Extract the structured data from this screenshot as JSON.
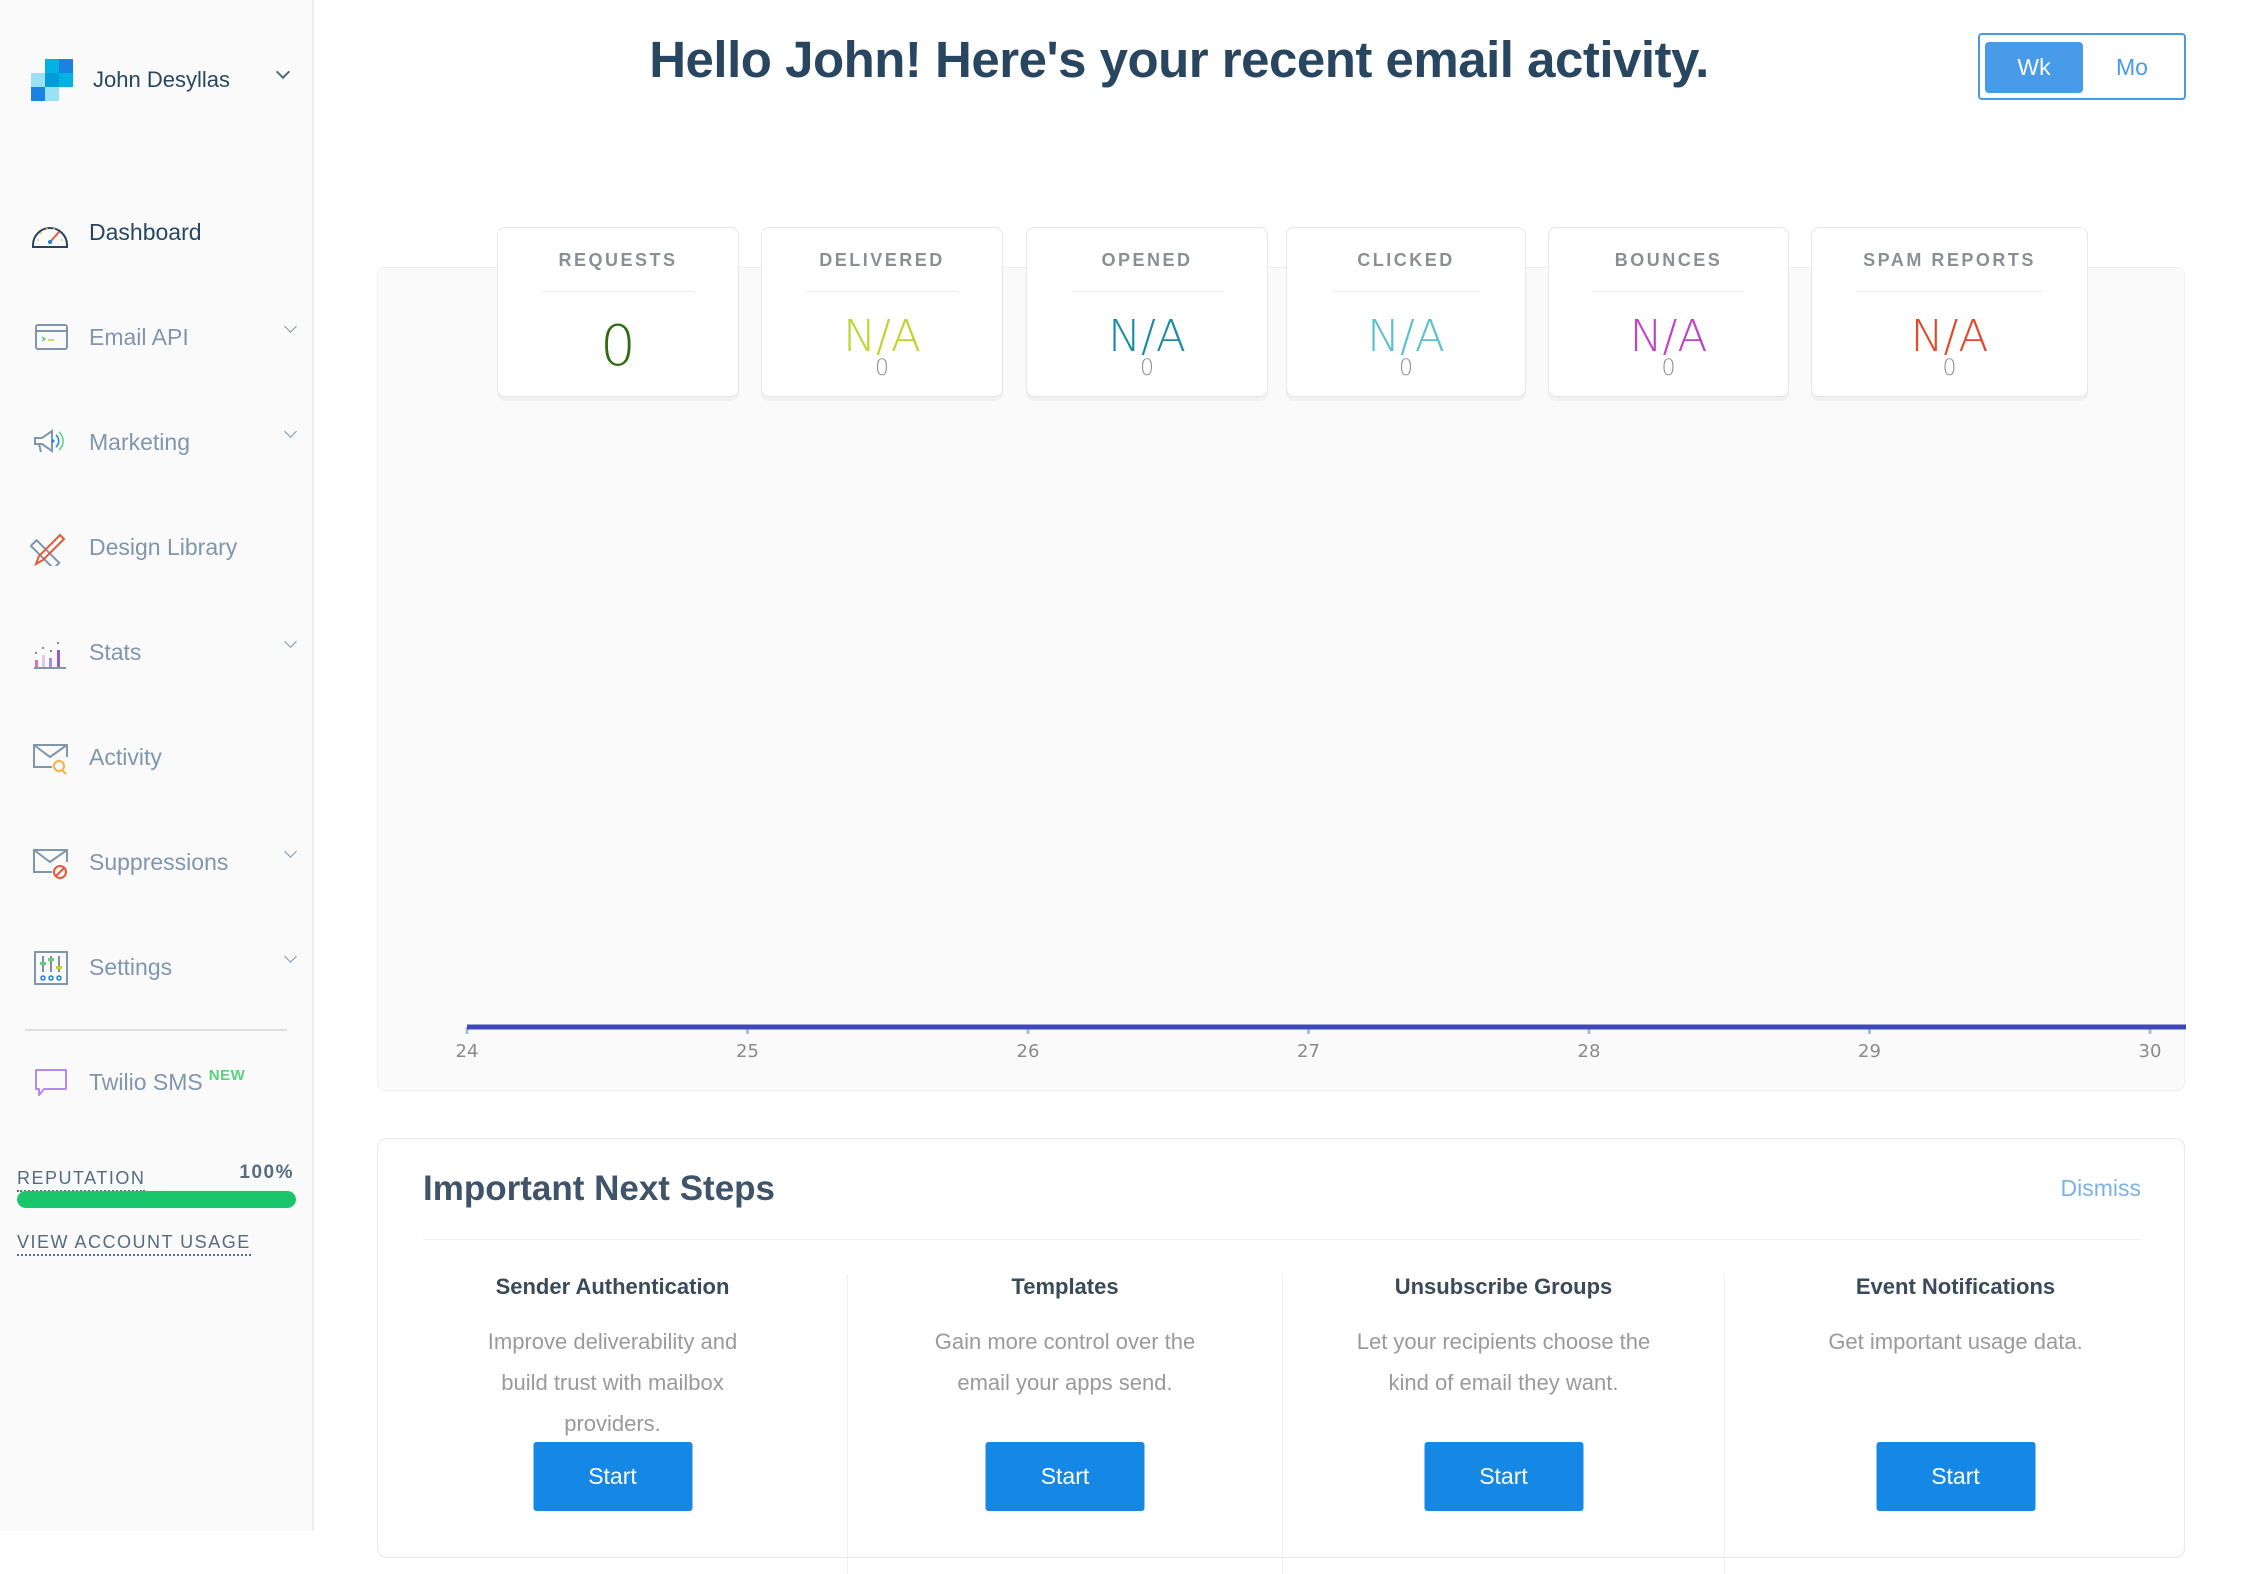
{
  "account": {
    "name": "John Desyllas"
  },
  "sidebar": {
    "items": [
      {
        "label": "Dashboard",
        "icon": "dashboard-gauge-icon",
        "active": true,
        "expandable": false
      },
      {
        "label": "Email API",
        "icon": "terminal-window-icon",
        "active": false,
        "expandable": true
      },
      {
        "label": "Marketing",
        "icon": "megaphone-icon",
        "active": false,
        "expandable": true
      },
      {
        "label": "Design Library",
        "icon": "pencil-ruler-icon",
        "active": false,
        "expandable": false
      },
      {
        "label": "Stats",
        "icon": "bar-chart-icon",
        "active": false,
        "expandable": true
      },
      {
        "label": "Activity",
        "icon": "envelope-search-icon",
        "active": false,
        "expandable": false
      },
      {
        "label": "Suppressions",
        "icon": "envelope-blocked-icon",
        "active": false,
        "expandable": true
      },
      {
        "label": "Settings",
        "icon": "sliders-icon",
        "active": false,
        "expandable": true
      }
    ],
    "twilio": {
      "label": "Twilio SMS",
      "badge": "NEW",
      "icon": "chat-bubble-icon"
    },
    "reputation": {
      "label": "REPUTATION",
      "value_text": "100%",
      "percent": 100,
      "color": "#1ac66b"
    },
    "usage_link": "VIEW ACCOUNT USAGE"
  },
  "header": {
    "title": "Hello John! Here's your recent email activity.",
    "toggle": {
      "options": [
        "Wk",
        "Mo"
      ],
      "selected": "Wk"
    }
  },
  "stats": [
    {
      "label": "REQUESTS",
      "value": "0",
      "sub": "",
      "color": "#2f6b10"
    },
    {
      "label": "DELIVERED",
      "value": "N/A",
      "sub": "0",
      "color": "#bcd52e"
    },
    {
      "label": "OPENED",
      "value": "N/A",
      "sub": "0",
      "color": "#1a8ba7"
    },
    {
      "label": "CLICKED",
      "value": "N/A",
      "sub": "0",
      "color": "#59c1cf"
    },
    {
      "label": "BOUNCES",
      "value": "N/A",
      "sub": "0",
      "color": "#c041c2"
    },
    {
      "label": "SPAM REPORTS",
      "value": "N/A",
      "sub": "0",
      "color": "#e5472a"
    }
  ],
  "chart_data": {
    "type": "line",
    "title": "",
    "xlabel": "",
    "ylabel": "",
    "x": [
      24,
      25,
      26,
      27,
      28,
      29,
      30
    ],
    "series": [
      {
        "name": "Requests",
        "values": [
          0,
          0,
          0,
          0,
          0,
          0,
          0
        ],
        "color": "#3f48b8"
      }
    ],
    "tick_labels": [
      "24",
      "25",
      "26",
      "27",
      "28",
      "29",
      "30"
    ],
    "grid": false,
    "legend": "none"
  },
  "next_steps": {
    "title": "Important Next Steps",
    "dismiss_label": "Dismiss",
    "items": [
      {
        "title": "Sender Authentication",
        "description": "Improve deliverability and build trust with mailbox providers.",
        "button": "Start"
      },
      {
        "title": "Templates",
        "description": "Gain more control over the email your apps send.",
        "button": "Start"
      },
      {
        "title": "Unsubscribe Groups",
        "description": "Let your recipients choose the kind of email they want.",
        "button": "Start"
      },
      {
        "title": "Event Notifications",
        "description": "Get important usage data.",
        "button": "Start"
      }
    ]
  }
}
